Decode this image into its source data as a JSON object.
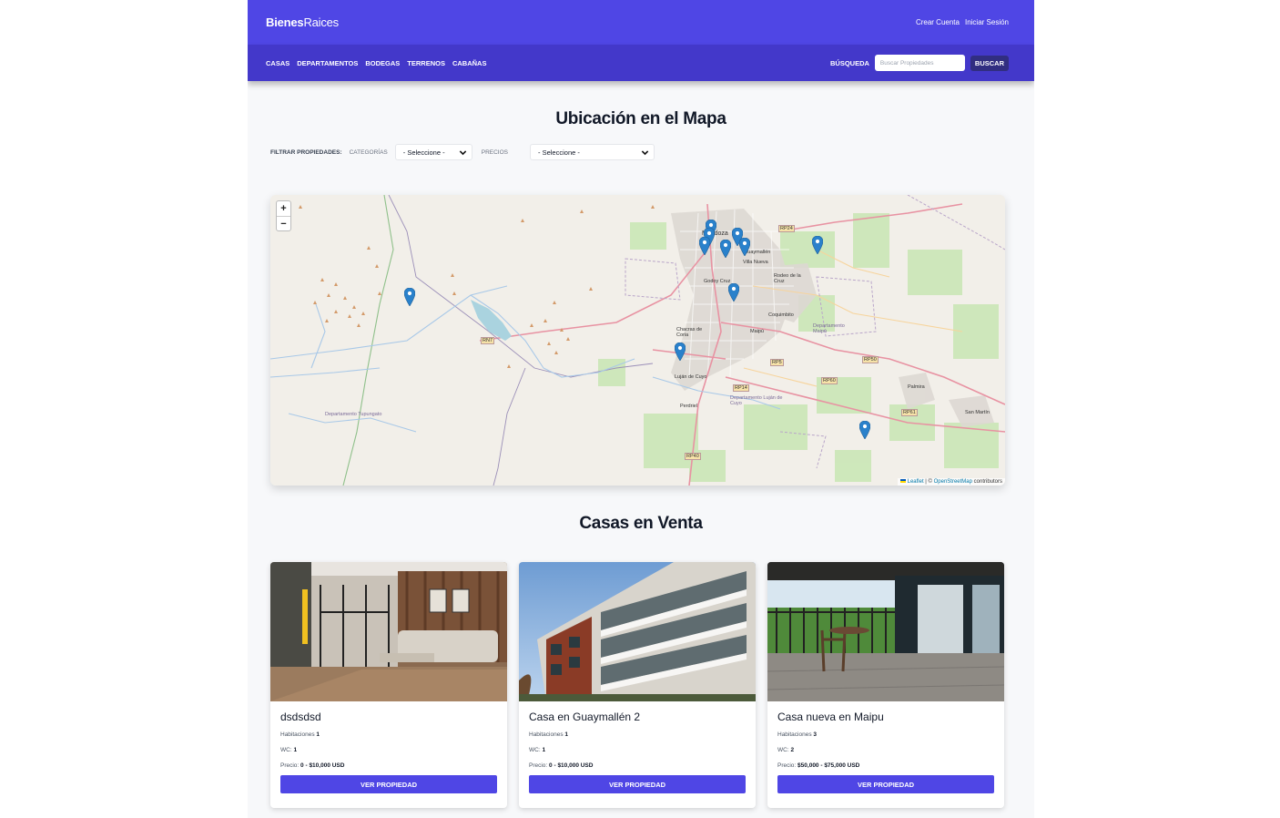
{
  "header": {
    "logo_bold": "Bienes",
    "logo_rest": "Raices",
    "create_account": "Crear Cuenta",
    "login": "Iniciar Sesión"
  },
  "nav": {
    "items": [
      "Casas",
      "Departamentos",
      "Bodegas",
      "Terrenos",
      "Cabañas"
    ],
    "search_label": "BÚSQUEDA",
    "search_placeholder": "Buscar Propiedades",
    "search_button": "BUSCAR"
  },
  "map_section": {
    "title": "Ubicación en el Mapa",
    "filter_label": "FILTRAR PROPIEDADES:",
    "categories_label": "Categorías",
    "categories_value": "- Seleccione -",
    "prices_label": "Precios",
    "prices_value": "- Seleccione -",
    "zoom_in": "+",
    "zoom_out": "−",
    "attribution_leaflet": "Leaflet",
    "attribution_sep": " | © ",
    "attribution_osm": "OpenStreetMap",
    "attribution_tail": " contributors",
    "place_labels": {
      "mendoza": "Mendoza",
      "godoy_cruz": "Godoy Cruz",
      "guaymallen": "Guaymallén",
      "villa_nueva": "Villa Nueva",
      "rodeo_cruz": "Rodeo de la Cruz",
      "coquimbito": "Coquimbito",
      "maipu": "Maipú",
      "chacras": "Chacras de Coria",
      "lujan": "Luján de Cuyo",
      "perdriel": "Perdriel",
      "palmira": "Palmira",
      "san_martin": "San Martín",
      "dep_maipu": "Departamento Maipú",
      "dep_lujan": "Departamento Luján de Cuyo",
      "dep_tupungato": "Departamento Tupungato",
      "rn7": "RN7",
      "rp24": "RP24",
      "rp50": "RP50",
      "rp60": "RP60",
      "rp61": "RP61",
      "rp14": "RP14",
      "rp5": "RP5",
      "rp40": "RP40"
    }
  },
  "listings": {
    "title": "Casas en Venta",
    "rooms_label": "Habitaciones",
    "wc_label": "WC:",
    "price_label": "Precio:",
    "button_label": "Ver Propiedad",
    "items": [
      {
        "title": "dsdsdsd",
        "rooms": "1",
        "wc": "1",
        "price": "0 - $10,000 USD"
      },
      {
        "title": "Casa en Guaymallén 2",
        "rooms": "1",
        "wc": "1",
        "price": "0 - $10,000 USD"
      },
      {
        "title": "Casa nueva en Maipu",
        "rooms": "3",
        "wc": "2",
        "price": "$50,000 - $75,000 USD"
      }
    ]
  },
  "colors": {
    "header": "#4f46e5",
    "nav": "#4338ca",
    "button": "#4f46e5",
    "marker": "#2a81cb"
  }
}
